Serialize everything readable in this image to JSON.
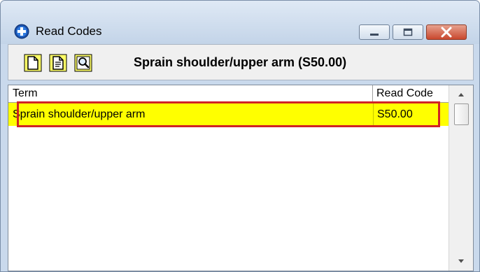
{
  "window": {
    "title": "Read Codes",
    "icon": "blue-circle-plus-icon",
    "controls": [
      "minimize-icon",
      "maximize-icon",
      "close-icon"
    ]
  },
  "toolbar": {
    "icons": [
      "new-document-icon",
      "document-details-icon",
      "magnifier-search-icon"
    ],
    "selected_title": "Sprain shoulder/upper arm (S50.00)"
  },
  "grid": {
    "columns": [
      "Term",
      "Read Code"
    ],
    "rows": [
      {
        "term": "Sprain shoulder/upper arm",
        "code": "S50.00"
      }
    ],
    "highlight_color": "#ffff00",
    "annotation_color": "#d12424"
  }
}
